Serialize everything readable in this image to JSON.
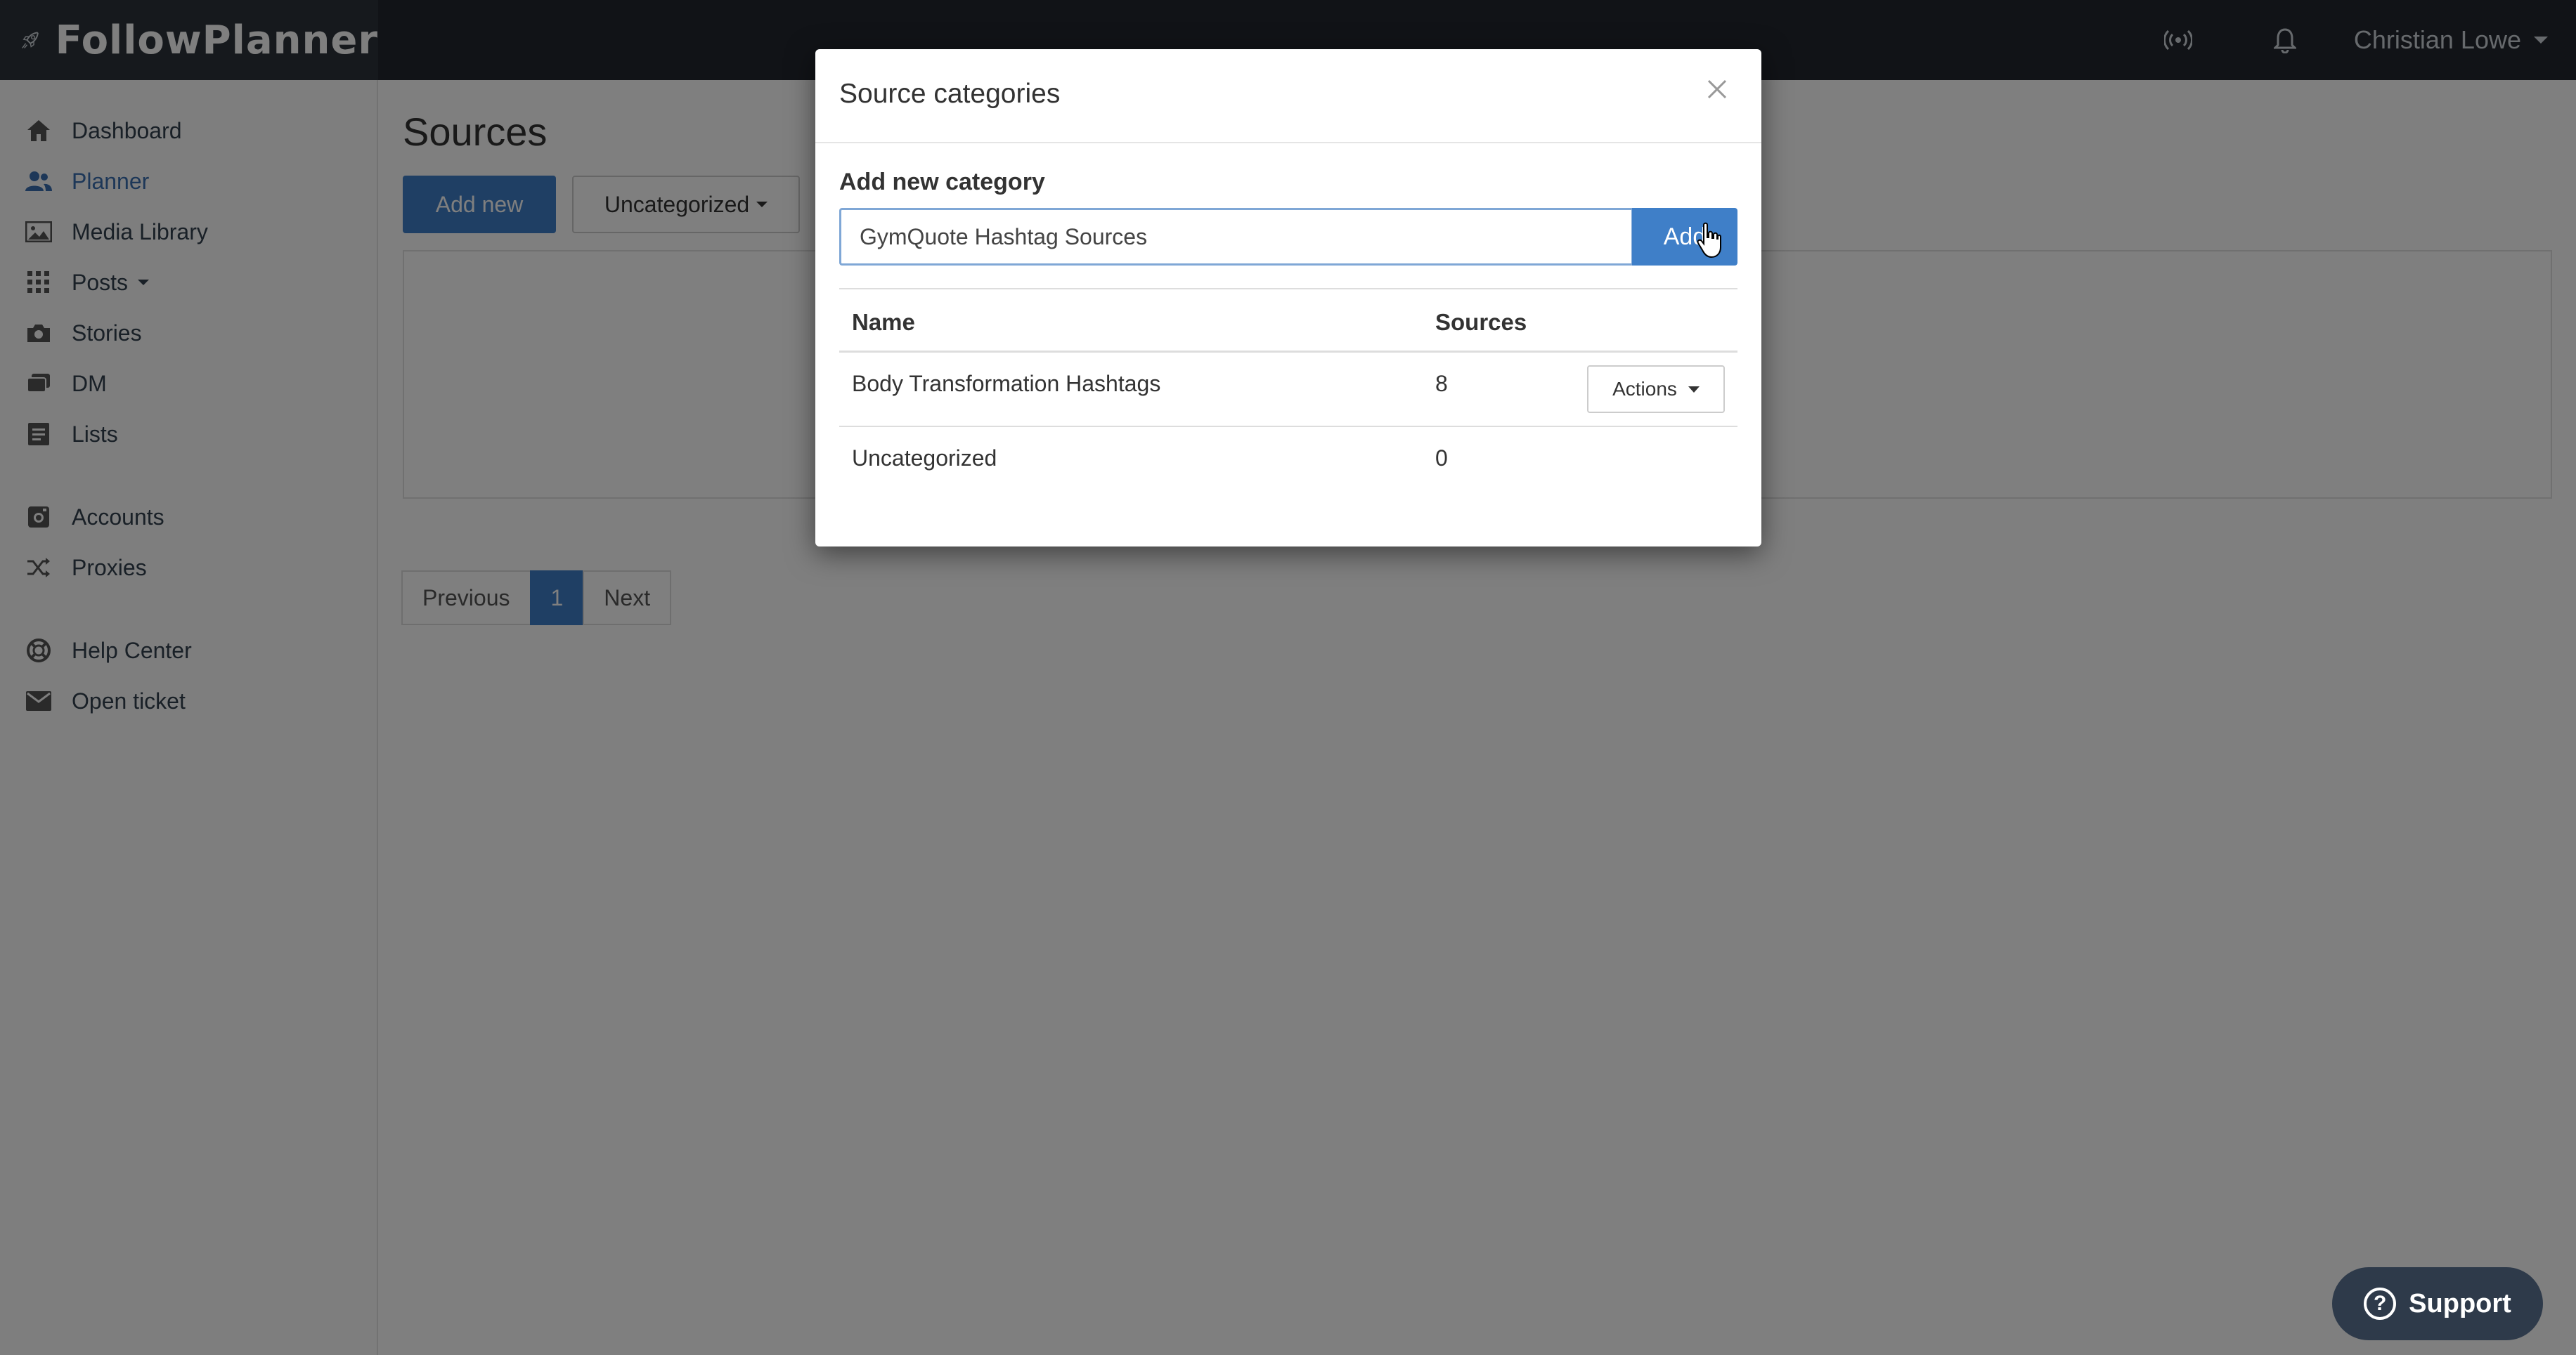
{
  "app": {
    "name": "FollowPlanner"
  },
  "header": {
    "user_name": "Christian Lowe",
    "icons": [
      "broadcast-icon",
      "bell-icon",
      "rocket-icon"
    ]
  },
  "sidebar": {
    "items": [
      {
        "label": "Dashboard",
        "icon": "home-icon"
      },
      {
        "label": "Planner",
        "icon": "users-icon",
        "active": true
      },
      {
        "label": "Media Library",
        "icon": "image-icon"
      },
      {
        "label": "Posts",
        "icon": "grid-icon"
      },
      {
        "label": "Stories",
        "icon": "camera-icon"
      },
      {
        "label": "DM",
        "icon": "chat-icon"
      },
      {
        "label": "Lists",
        "icon": "list-icon"
      },
      {
        "label": "Accounts",
        "icon": "instagram-icon"
      },
      {
        "label": "Proxies",
        "icon": "shuffle-icon"
      },
      {
        "label": "Help Center",
        "icon": "lifebuoy-icon"
      },
      {
        "label": "Open ticket",
        "icon": "envelope-icon"
      }
    ]
  },
  "main": {
    "title": "Sources",
    "add_new_label": "Add new",
    "category_filter_label": "Uncategorized"
  },
  "pagination": {
    "previous": "Previous",
    "current": "1",
    "next": "Next"
  },
  "modal": {
    "title": "Source categories",
    "add_label": "Add new category",
    "input_value": "GymQuote Hashtag Sources",
    "add_button": "Add",
    "table": {
      "headers": [
        "Name",
        "Sources"
      ],
      "rows": [
        {
          "name": "Body Transformation Hashtags",
          "sources": "8",
          "actions": "Actions"
        },
        {
          "name": "Uncategorized",
          "sources": "0"
        }
      ]
    }
  },
  "support": {
    "label": "Support"
  },
  "colors": {
    "primary": "#3f7fc8",
    "topbar": "#22272e",
    "overlay": "rgba(0,0,0,0.5)"
  }
}
